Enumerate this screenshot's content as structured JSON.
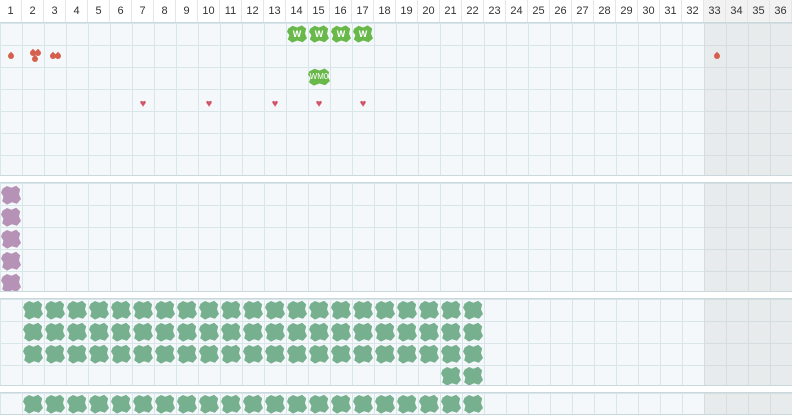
{
  "columns": [
    "1",
    "2",
    "3",
    "4",
    "5",
    "6",
    "7",
    "8",
    "9",
    "10",
    "11",
    "12",
    "13",
    "14",
    "15",
    "16",
    "17",
    "18",
    "19",
    "20",
    "21",
    "22",
    "23",
    "24",
    "25",
    "26",
    "27",
    "28",
    "29",
    "30",
    "31",
    "32",
    "33",
    "34",
    "35",
    "36"
  ],
  "w_tile_label": "W",
  "wm_tile_label": "WM0",
  "colors": {
    "grid_bg": "#f4f8fa",
    "grid_line": "#d8e6ea",
    "shaded_cols": "#ededed",
    "green_tile": "#68b84a",
    "teal_tile": "#77b08f",
    "purple_tile": "#b692b6",
    "heart": "#d2546a",
    "drop": "#d6604e"
  },
  "icons": {
    "w_tile": "w-tile-icon",
    "wm_tile": "wm-tile-icon",
    "heart": "heart-icon",
    "drop": "drop-icon",
    "teal_tile": "teal-tile-icon",
    "purple_tile": "purple-tile-icon"
  },
  "shaded_columns": [
    "33",
    "34",
    "35",
    "36"
  ],
  "band1": {
    "w_tiles_at_columns": [
      "14",
      "15",
      "16",
      "17"
    ],
    "wm_tile_at_column": "15",
    "hearts_at_columns": [
      "7",
      "10",
      "13",
      "15",
      "17"
    ],
    "drops_at_columns": [
      "1",
      "2",
      "3",
      "33"
    ]
  },
  "band2": {
    "purple_tiles_column": "1",
    "purple_tile_count": 5
  },
  "band3": {
    "teal_rows_columns": "2-22",
    "teal_full_rows": 3,
    "extra_row_columns": [
      "21",
      "22"
    ]
  },
  "band4": {
    "teal_row_columns": "2-22"
  }
}
